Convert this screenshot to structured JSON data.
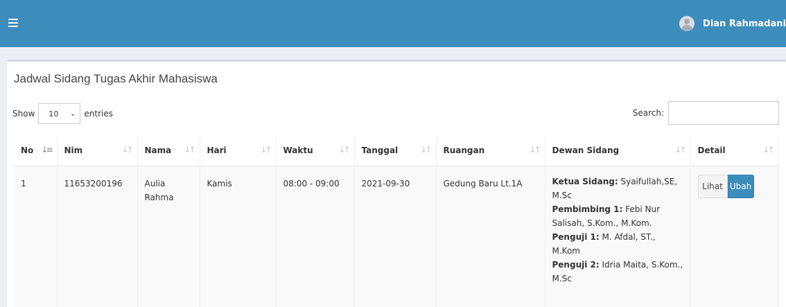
{
  "header": {
    "menu_icon": "hamburger-icon",
    "user_name": "Dian Rahmadani",
    "brand_color": "#3c8dbc"
  },
  "box": {
    "title": "Jadwal Sidang Tugas Akhir Mahasiswa"
  },
  "length_control": {
    "show_label": "Show",
    "selected_value": "10",
    "entries_label": "entries"
  },
  "search": {
    "label": "Search:",
    "value": "",
    "placeholder": ""
  },
  "table": {
    "columns": [
      "No",
      "Nim",
      "Nama",
      "Hari",
      "Waktu",
      "Tanggal",
      "Ruangan",
      "Dewan Sidang",
      "Detail"
    ],
    "rows": [
      {
        "no": "1",
        "nim": "11653200196",
        "nama": "Aulia Rahma",
        "hari": "Kamis",
        "waktu": "08:00 - 09:00",
        "tanggal": "2021-09-30",
        "ruangan": "Gedung Baru Lt.1A",
        "dewan": [
          {
            "role": "Ketua Sidang:",
            "name": "Syaifullah,SE, M.Sc"
          },
          {
            "role": "Pembimbing 1:",
            "name": "Febi Nur Salisah, S.Kom., M.Kom."
          },
          {
            "role": "Penguji 1:",
            "name": "M. Afdal, ST., M.Kom"
          },
          {
            "role": "Penguji 2:",
            "name": "Idria Maita, S.Kom., M.Sc"
          }
        ],
        "actions": {
          "lihat": "Lihat",
          "ubah": "Ubah"
        }
      }
    ]
  }
}
